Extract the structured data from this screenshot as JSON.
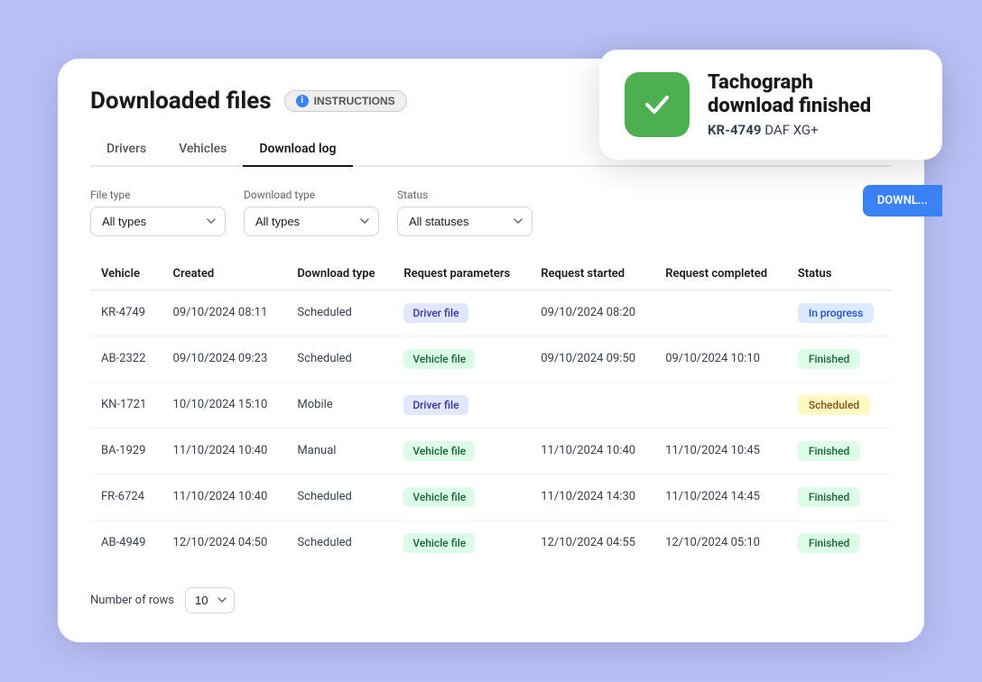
{
  "page": {
    "title": "Downloaded files",
    "instructions_label": "INSTRUCTIONS"
  },
  "tabs": [
    {
      "label": "Drivers",
      "active": false
    },
    {
      "label": "Vehicles",
      "active": false
    },
    {
      "label": "Download log",
      "active": true
    }
  ],
  "filters": {
    "file_type_label": "File type",
    "file_type_value": "All types",
    "download_type_label": "Download type",
    "download_type_value": "All types",
    "status_label": "Status",
    "status_value": "All statuses"
  },
  "table": {
    "headers": [
      "Vehicle",
      "Created",
      "Download type",
      "Request parameters",
      "Request started",
      "Request completed",
      "Status"
    ],
    "rows": [
      {
        "vehicle": "KR-4749",
        "created": "09/10/2024 08:11",
        "download_type": "Scheduled",
        "request_params": "Driver file",
        "request_params_type": "driver",
        "request_started": "09/10/2024 08:20",
        "request_completed": "",
        "status": "In progress",
        "status_type": "inprogress"
      },
      {
        "vehicle": "AB-2322",
        "created": "09/10/2024 09:23",
        "download_type": "Scheduled",
        "request_params": "Vehicle file",
        "request_params_type": "vehicle",
        "request_started": "09/10/2024 09:50",
        "request_completed": "09/10/2024 10:10",
        "status": "Finished",
        "status_type": "finished"
      },
      {
        "vehicle": "KN-1721",
        "created": "10/10/2024 15:10",
        "download_type": "Mobile",
        "request_params": "Driver file",
        "request_params_type": "driver",
        "request_started": "",
        "request_completed": "",
        "status": "Scheduled",
        "status_type": "scheduled"
      },
      {
        "vehicle": "BA-1929",
        "created": "11/10/2024 10:40",
        "download_type": "Manual",
        "request_params": "Vehicle file",
        "request_params_type": "vehicle",
        "request_started": "11/10/2024 10:40",
        "request_completed": "11/10/2024 10:45",
        "status": "Finished",
        "status_type": "finished"
      },
      {
        "vehicle": "FR-6724",
        "created": "11/10/2024 10:40",
        "download_type": "Scheduled",
        "request_params": "Vehicle file",
        "request_params_type": "vehicle",
        "request_started": "11/10/2024 14:30",
        "request_completed": "11/10/2024 14:45",
        "status": "Finished",
        "status_type": "finished"
      },
      {
        "vehicle": "AB-4949",
        "created": "12/10/2024 04:50",
        "download_type": "Scheduled",
        "request_params": "Vehicle file",
        "request_params_type": "vehicle",
        "request_started": "12/10/2024 04:55",
        "request_completed": "12/10/2024 05:10",
        "status": "Finished",
        "status_type": "finished"
      }
    ]
  },
  "footer": {
    "rows_label": "Number of rows",
    "rows_value": "10"
  },
  "notification": {
    "title": "Tachograph\ndownload finished",
    "vehicle_id": "KR-4749",
    "vehicle_model": "DAF XG+"
  },
  "dl_bar_label": "DOWNL..."
}
